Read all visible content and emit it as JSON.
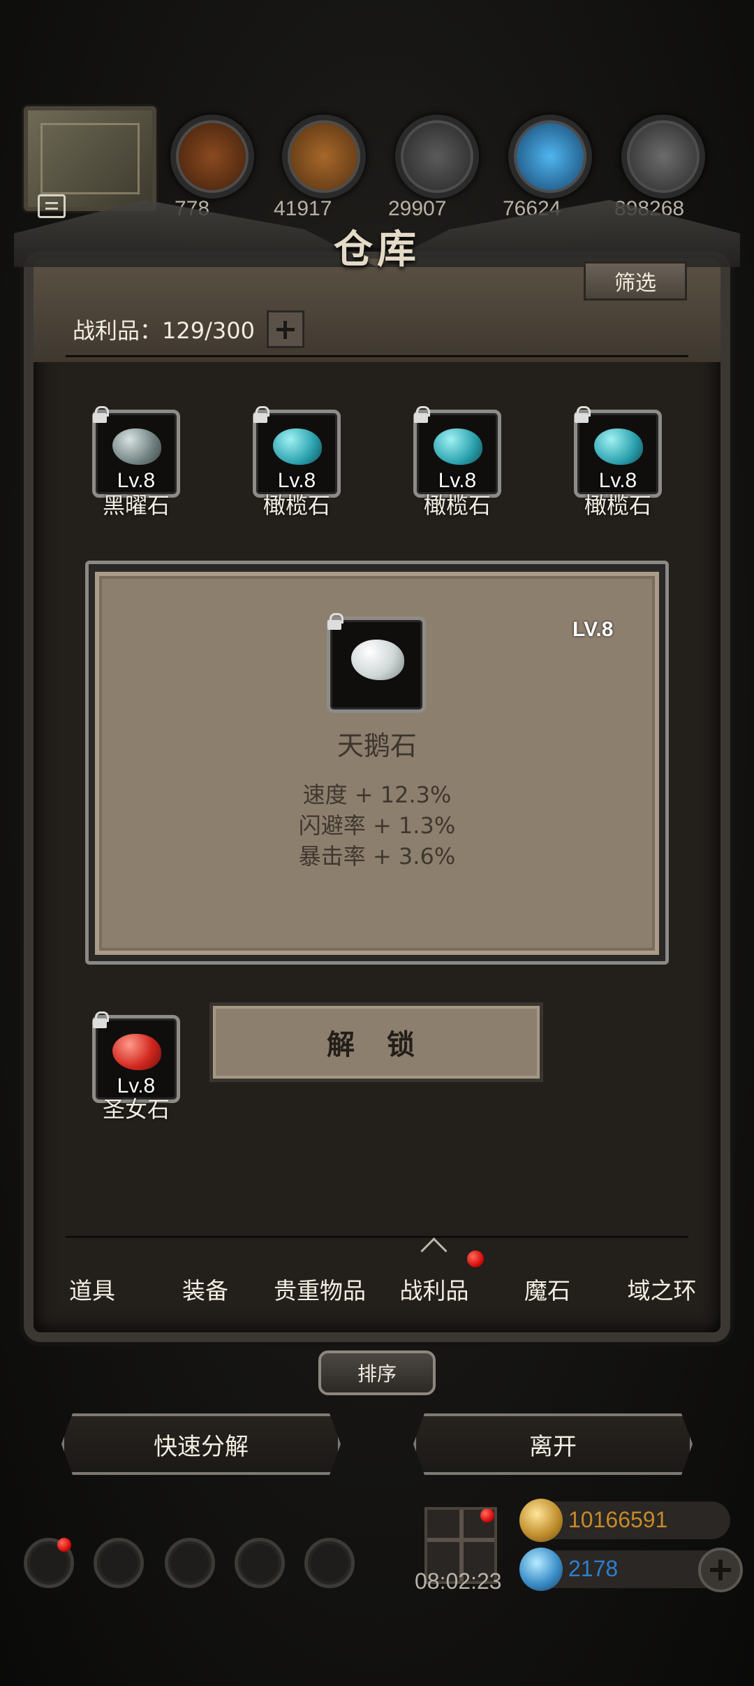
{
  "top_bar": {
    "resources": [
      {
        "icon": "wood-resource-icon",
        "value": "778"
      },
      {
        "icon": "plank-resource-icon",
        "value": "41917"
      },
      {
        "icon": "iron-resource-icon",
        "value": "29907"
      },
      {
        "icon": "crystal-resource-icon",
        "value": "76624"
      },
      {
        "icon": "ore-resource-icon",
        "value": "898268"
      }
    ]
  },
  "warehouse": {
    "title": "仓库",
    "filter_label": "筛选",
    "loot_label": "战利品：129/300"
  },
  "grid": {
    "row1": [
      {
        "name": "黑曜石",
        "level": "Lv.8",
        "gem_color": "#7f8c8c"
      },
      {
        "name": "橄榄石",
        "level": "Lv.8",
        "gem_color": "#2aa0ad"
      },
      {
        "name": "橄榄石",
        "level": "Lv.8",
        "gem_color": "#2aa0ad"
      },
      {
        "name": "橄榄石",
        "level": "Lv.8",
        "gem_color": "#2aa0ad"
      }
    ],
    "row3": [
      {
        "name": "圣女石",
        "level": "Lv.8",
        "gem_color": "#d2281f"
      }
    ]
  },
  "detail": {
    "level": "LV.8",
    "name": "天鹅石",
    "stats": [
      "速度 + 12.3%",
      "闪避率 + 1.3%",
      "暴击率 + 3.6%"
    ],
    "unlock_label": "解 锁"
  },
  "tabs": [
    {
      "label": "道具",
      "active": false
    },
    {
      "label": "装备",
      "active": false
    },
    {
      "label": "贵重物品",
      "active": false
    },
    {
      "label": "战利品",
      "active": true
    },
    {
      "label": "魔石",
      "active": false
    },
    {
      "label": "域之环",
      "active": false
    }
  ],
  "sort_label": "排序",
  "actions": {
    "quick_decompose": "快速分解",
    "leave": "离开"
  },
  "hud": {
    "timer": "08:02:23",
    "gold": "10166591",
    "diamonds": "2178"
  },
  "colors": {
    "gold_text": "#c58a2a",
    "diamond_text": "#2f7fd0",
    "notify_red": "#d80e0e"
  }
}
